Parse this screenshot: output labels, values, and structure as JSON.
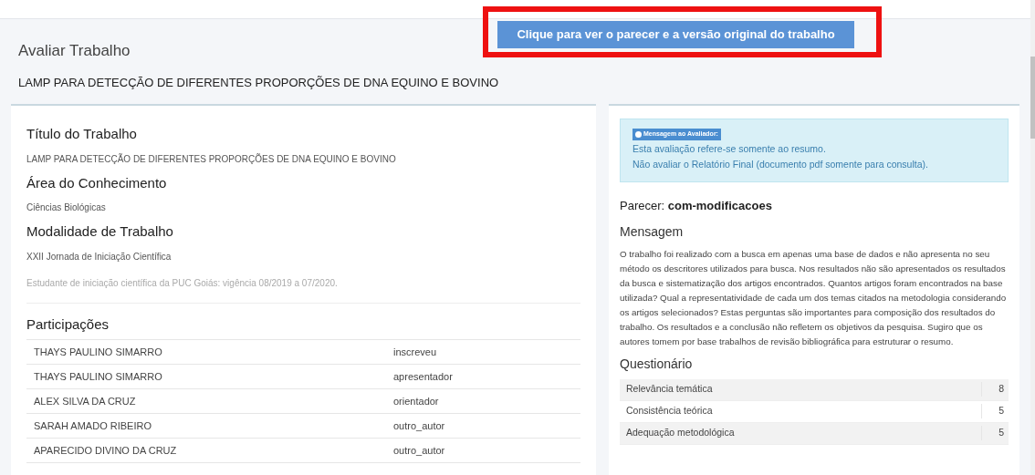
{
  "header": {
    "button": "Clique para ver o parecer e a versão original do trabalho",
    "title": "Avaliar Trabalho",
    "subtitle": "LAMP PARA DETECÇÃO DE DIFERENTES PROPORÇÕES DE DNA EQUINO E BOVINO"
  },
  "details": [
    {
      "label": "Título do Trabalho",
      "value": "LAMP PARA DETECÇÃO DE DIFERENTES PROPORÇÕES DE DNA EQUINO E BOVINO"
    },
    {
      "label": "Área do Conhecimento",
      "value": "Ciências Biológicas"
    },
    {
      "label": "Modalidade de Trabalho",
      "value": "XXII Jornada de Iniciação Científica"
    }
  ],
  "note": "Estudante de iniciação científica da PUC Goiás: vigência 08/2019 a 07/2020.",
  "participations": {
    "title": "Participações",
    "rows": [
      {
        "name": "THAYS PAULINO SIMARRO",
        "role": "inscreveu"
      },
      {
        "name": "THAYS PAULINO SIMARRO",
        "role": "apresentador"
      },
      {
        "name": "ALEX SILVA DA CRUZ",
        "role": "orientador"
      },
      {
        "name": "SARAH AMADO RIBEIRO",
        "role": "outro_autor"
      },
      {
        "name": "APARECIDO DIVINO DA CRUZ",
        "role": "outro_autor"
      }
    ]
  },
  "alert": {
    "badge": "Mensagem ao Avaliador:",
    "lines": [
      "Esta avaliação refere-se somente ao resumo.",
      "Não avaliar o Relatório Final (documento pdf somente para consulta)."
    ]
  },
  "verdict": "Parecer: **com-modificacoes**",
  "message": {
    "title": "Mensagem",
    "text": "O trabalho foi realizado com a busca em apenas uma base de dados e não apresenta no seu método os descritores utilizados para busca. Nos resultados não são apresentados os resultados da busca e sistematização dos artigos encontrados. Quantos artigos foram encontrados na base utilizada? Qual a representatividade de cada um dos temas citados na metodologia considerando os artigos selecionados? Estas perguntas são importantes para composição dos resultados do trabalho. Os resultados e a conclusão não refletem os objetivos da pesquisa. Sugiro que os autores tomem por base trabalhos de revisão bibliográfica para estruturar o resumo."
  },
  "questionnaire": {
    "title": "Questionário",
    "rows": [
      {
        "criterion": "Relevância temática",
        "score": "8"
      },
      {
        "criterion": "Consistência teórica",
        "score": "5"
      },
      {
        "criterion": "Adequação metodológica",
        "score": "5"
      }
    ]
  }
}
